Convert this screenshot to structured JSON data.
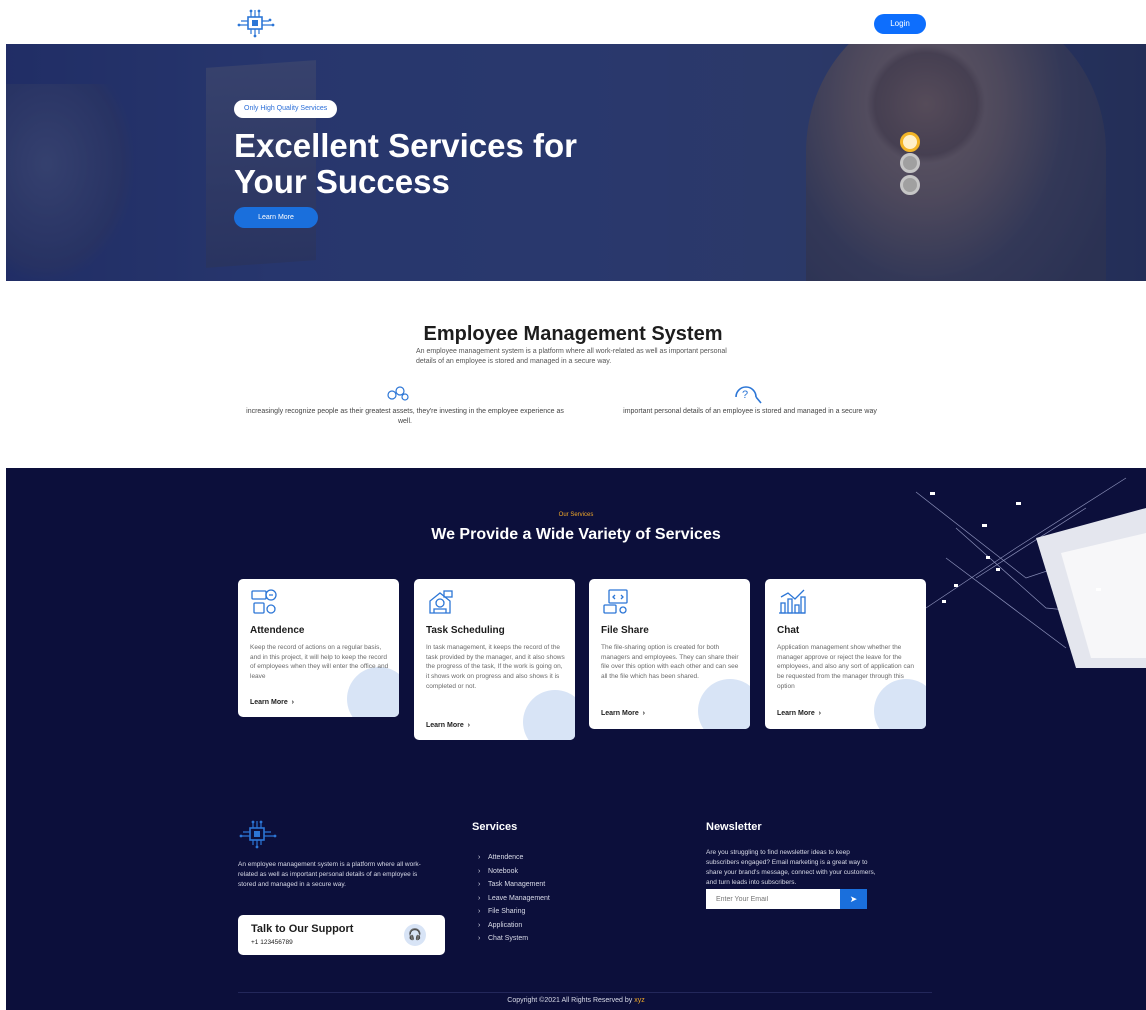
{
  "header": {
    "login_label": "Login"
  },
  "hero": {
    "badge": "Only High Quality Services",
    "title_line1": "Excellent Services for",
    "title_line2": "Your Success",
    "cta_label": "Learn More"
  },
  "about": {
    "title": "Employee Management System",
    "description": "An employee management system is a platform where all work-related as well as important personal details of an employee is stored and managed in a secure way.",
    "feature1_text": "increasingly recognize people as their greatest assets, they're investing in the employee experience as well.",
    "feature2_text": "important personal details of an employee is stored and managed in a secure way",
    "feature1_icon": "gears-icon",
    "feature2_icon": "question-icon"
  },
  "services": {
    "kicker": "Our Services",
    "title": "We Provide a Wide Variety of Services",
    "cards": [
      {
        "title": "Attendence",
        "icon": "attendance-icon",
        "description": "Keep the record of actions on a regular basis, and in this project, it will help to keep the record of employees when they will enter the office and leave",
        "link": "Learn More"
      },
      {
        "title": "Task Scheduling",
        "icon": "task-icon",
        "description": "In task management, it keeps the record of the task provided by the manager, and it also shows the progress of the task, If the work is going on, it shows work on progress and also shows it is completed or not.",
        "link": "Learn More"
      },
      {
        "title": "File Share",
        "icon": "file-share-icon",
        "description": "The file-sharing option is created for both managers and employees. They can share their file over this option with each other and can see all the file which has been shared.",
        "link": "Learn More"
      },
      {
        "title": "Chat",
        "icon": "chat-icon",
        "description": "Application management show whether the manager approve or reject the leave for the employees, and also any sort of application can be requested from the manager through this option",
        "link": "Learn More"
      }
    ]
  },
  "footer": {
    "description": "An employee management system is a platform where all work-related as well as important personal details of an employee is stored and managed in a secure way.",
    "support_title": "Talk to Our Support",
    "support_phone": "+1 123456789",
    "services_title": "Services",
    "services_items": [
      "Attendence",
      "Notebook",
      "Task Management",
      "Leave Management",
      "File Sharing",
      "Application",
      "Chat System"
    ],
    "newsletter_title": "Newsletter",
    "newsletter_desc": "Are you struggling to find newsletter ideas to keep subscribers engaged? Email marketing is a great way to share your brand's message, connect with your customers, and turn leads into subscribers.",
    "email_placeholder": "Enter Your Email",
    "copyright_text": "Copyright ©2021 All Rights Reserved by",
    "copyright_brand": "xyz"
  },
  "colors": {
    "primary": "#1a6fdc",
    "navy": "#0c0f3b",
    "accent": "#f2a929"
  }
}
